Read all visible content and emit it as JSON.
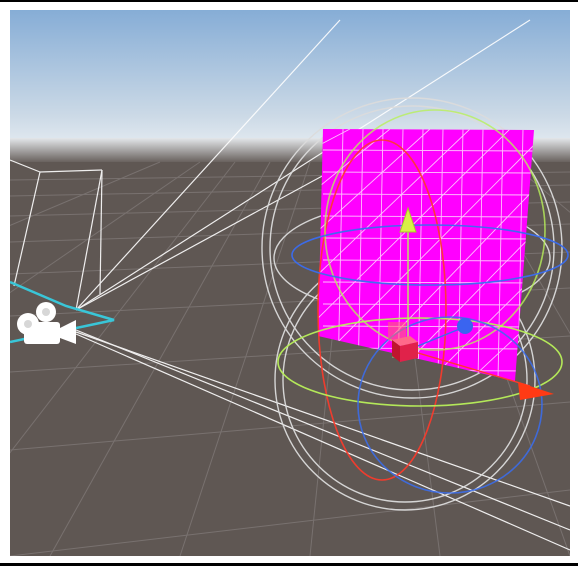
{
  "scene": {
    "colors": {
      "sky_top": "#86add6",
      "sky_bottom": "#e7edf2",
      "ground": "#5f5753",
      "grid": "#7d7674",
      "plane": "#ff00ff",
      "plane_wire": "#ffffff",
      "camera_frustum": "#ffffff",
      "camera_selection": "#39c6d8",
      "gizmo_x": "#ff3a2a",
      "gizmo_y": "#b8f05a",
      "gizmo_z": "#3a6df0",
      "rotate_ring": "#dcdcdc"
    },
    "icons": {
      "camera": "camera-icon",
      "gizmo_y": "y-axis-cone-icon",
      "gizmo_x": "x-axis-cone-icon",
      "gizmo_z": "z-axis-sphere-icon",
      "gizmo_center": "center-cube-icon"
    }
  }
}
